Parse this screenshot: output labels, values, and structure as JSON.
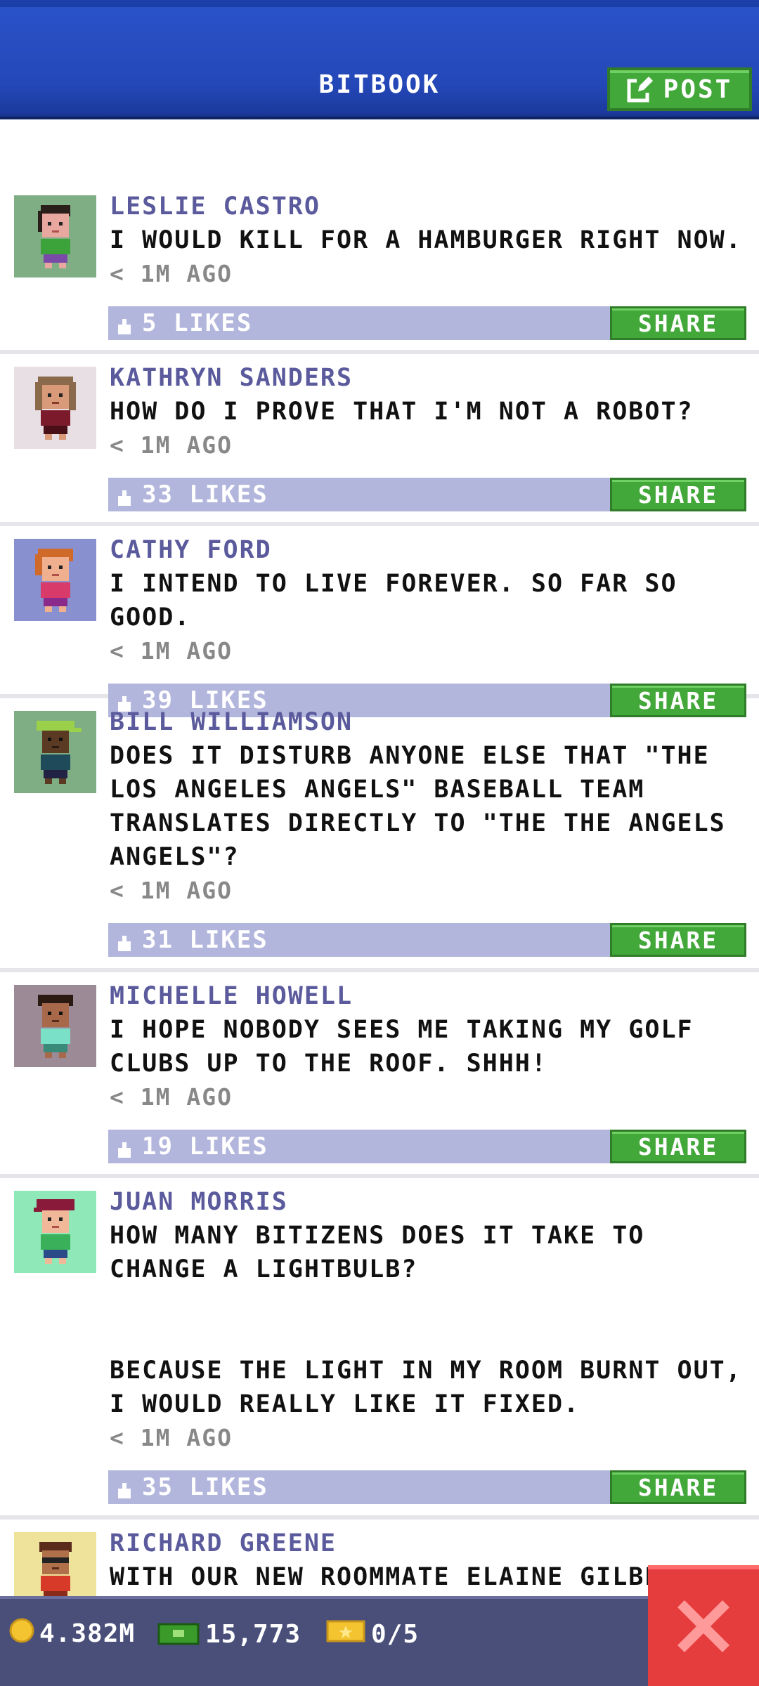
{
  "header": {
    "title": "BITBOOK",
    "post_label": "POST"
  },
  "posts": [
    {
      "author": "LESLIE CASTRO",
      "message": "I WOULD KILL FOR A HAMBURGER RIGHT NOW.",
      "time": "< 1M AGO",
      "likes": "5 LIKES",
      "share_label": "SHARE",
      "avatar_bg": "#7fae85"
    },
    {
      "author": "KATHRYN SANDERS",
      "message": "HOW DO I PROVE THAT I'M NOT A ROBOT?",
      "time": "< 1M AGO",
      "likes": "33 LIKES",
      "share_label": "SHARE",
      "avatar_bg": "#e8dfe4"
    },
    {
      "author": "CATHY FORD",
      "message": "I INTEND TO LIVE FOREVER. SO FAR SO GOOD.",
      "time": "< 1M AGO",
      "likes": "39 LIKES",
      "share_label": "SHARE",
      "avatar_bg": "#8890d0"
    },
    {
      "author": "BILL WILLIAMSON",
      "message": "DOES IT DISTURB ANYONE ELSE THAT \"THE LOS ANGELES ANGELS\" BASEBALL TEAM TRANSLATES DIRECTLY TO \"THE THE ANGELS ANGELS\"?",
      "time": "< 1M AGO",
      "likes": "31 LIKES",
      "share_label": "SHARE",
      "avatar_bg": "#7fae85"
    },
    {
      "author": "MICHELLE HOWELL",
      "message": "I HOPE NOBODY SEES ME TAKING MY GOLF CLUBS UP TO THE ROOF. SHHH!",
      "time": "< 1M AGO",
      "likes": "19 LIKES",
      "share_label": "SHARE",
      "avatar_bg": "#9c8a96"
    },
    {
      "author": "JUAN MORRIS",
      "message": "HOW MANY BITIZENS DOES IT TAKE TO CHANGE A LIGHTBULB?\n\n\nBECAUSE THE LIGHT IN MY ROOM BURNT OUT, I WOULD REALLY LIKE IT FIXED.",
      "time": "< 1M AGO",
      "likes": "35 LIKES",
      "share_label": "SHARE",
      "avatar_bg": "#8ee8b8"
    },
    {
      "author": "RICHARD GREENE",
      "message": "WITH OUR NEW ROOMMATE ELAINE GILBE",
      "time": "",
      "likes": "",
      "share_label": "",
      "avatar_bg": "#efe29a"
    }
  ],
  "bottom_bar": {
    "coins": "4.382M",
    "bux": "15,773",
    "tickets": "0/5"
  },
  "colors": {
    "header_blue": "#2448b8",
    "share_green": "#43a83a",
    "like_bar": "#b3b6dc",
    "author_purple": "#5a5a9c",
    "close_red": "#e53d3d"
  }
}
